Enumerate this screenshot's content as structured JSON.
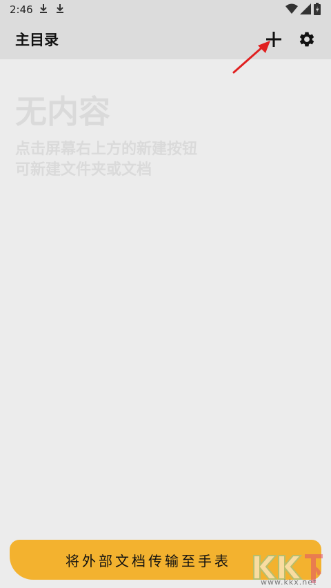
{
  "status_bar": {
    "time": "2:46"
  },
  "app_bar": {
    "title": "主目录"
  },
  "empty_state": {
    "title": "无内容",
    "hint_line1": "点击屏幕右上方的新建按钮",
    "hint_line2": "可新建文件夹或文档"
  },
  "bottom": {
    "transfer_label": "将外部文档传输至手表"
  },
  "watermark": {
    "url": "www.kkx.net"
  },
  "colors": {
    "accent": "#f3b22f",
    "annotation_arrow": "#e02020"
  },
  "icons": [
    "download-icon",
    "wifi-icon",
    "signal-icon",
    "battery-icon",
    "plus-icon",
    "gear-icon",
    "arrow-annotation",
    "kk-logo"
  ]
}
